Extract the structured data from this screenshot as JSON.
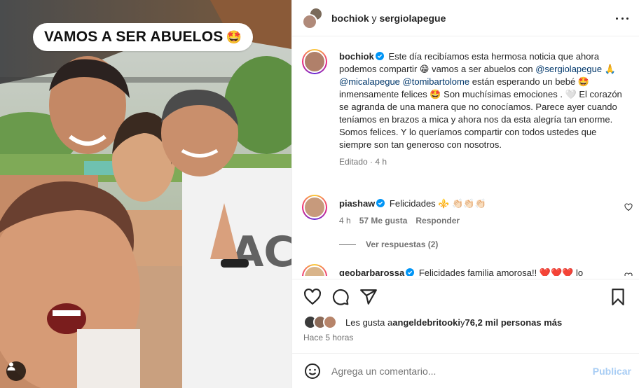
{
  "sticker": {
    "text": "VAMOS A SER ABUELOS",
    "emoji": "🤩"
  },
  "header": {
    "user1": "bochiok",
    "joiner": " y ",
    "user2": "sergiolapegue"
  },
  "caption": {
    "username": "bochiok",
    "t1": "Este día recibíamos esta hermosa noticia que ahora podemos compartir ",
    "e1": "😁",
    "t2": " vamos a ser abuelos con ",
    "m1": "@sergiolapegue",
    "e2": " 🙏",
    "m2": " @micalapegue",
    "m3": " @tomibartolome",
    "t3": " están esperando un bebé ",
    "e3": "🤩",
    "t4": " inmensamente felices ",
    "e4": "🤩",
    "t5": " Son muchísimas emociones . ",
    "e5": "🤍",
    "t6": " El corazón se agranda de una manera que no conocíamos. Parece ayer cuando teníamos en brazos a mica y ahora nos da esta alegría tan enorme. Somos felices. Y lo queríamos compartir con todos ustedes que siempre son tan generoso con nosotros.",
    "meta": "Editado · 4 h"
  },
  "comments": [
    {
      "username": "piashaw",
      "text": "Felicidades ",
      "emojis": "⚜️ 👏🏻👏🏻👏🏻",
      "time": "4 h",
      "likes": "57 Me gusta",
      "reply": "Responder",
      "replies": "Ver respuestas (2)"
    },
    {
      "username": "geobarbarossa",
      "text": "Felicidades familia amorosa!! ",
      "emojis": "❤️❤️❤️",
      "tail": " lo"
    }
  ],
  "likes": {
    "prefix": "Les gusta a ",
    "user": "angeldebritooki",
    "mid": " y ",
    "count": "76,2 mil personas más"
  },
  "time_ago": "Hace 5 horas",
  "comment_box": {
    "placeholder": "Agrega un comentario...",
    "post": "Publicar"
  },
  "colors": {
    "link": "#00376b",
    "verified": "#0095f6",
    "publish": "#a8cdf4",
    "border": "#efefef",
    "heart": "#ff3040"
  },
  "icons": [
    "user-tag-icon",
    "more-icon",
    "verified-icon",
    "heart-icon",
    "comment-icon",
    "share-icon",
    "save-icon",
    "emoji-icon"
  ]
}
